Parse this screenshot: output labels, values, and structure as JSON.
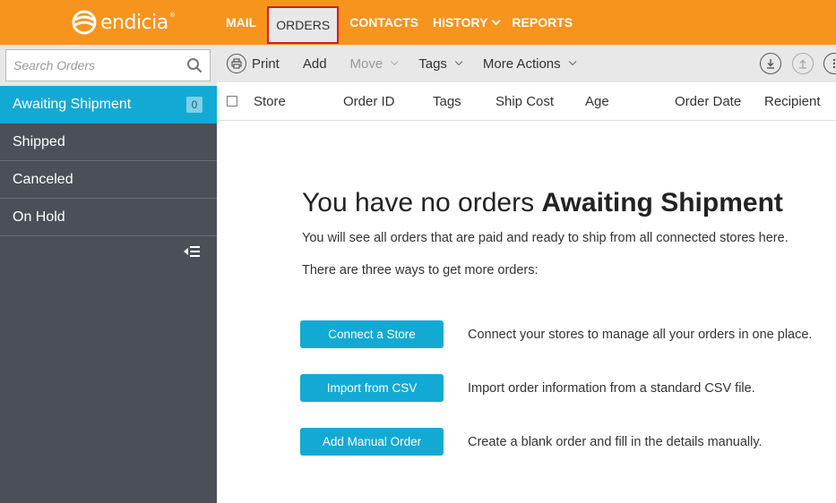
{
  "brand": {
    "name": "endicia",
    "mark": "®"
  },
  "nav": [
    {
      "label": "MAIL"
    },
    {
      "label": "ORDERS"
    },
    {
      "label": "CONTACTS"
    },
    {
      "label": "HISTORY"
    },
    {
      "label": "REPORTS"
    }
  ],
  "search": {
    "placeholder": "Search Orders"
  },
  "sidebar": {
    "items": [
      {
        "label": "Awaiting Shipment",
        "count": "0"
      },
      {
        "label": "Shipped"
      },
      {
        "label": "Canceled"
      },
      {
        "label": "On Hold"
      }
    ]
  },
  "toolbar": {
    "print": "Print",
    "add": "Add",
    "move": "Move",
    "tags": "Tags",
    "more_actions": "More Actions"
  },
  "table": {
    "columns": [
      "Store",
      "Order ID",
      "Tags",
      "Ship Cost",
      "Age",
      "Order Date",
      "Recipient"
    ]
  },
  "empty_state": {
    "title_prefix": "You have no orders ",
    "title_bold": "Awaiting Shipment",
    "subtitle": "You will see all orders that are paid and ready to ship from all connected stores here.",
    "ways_intro": "There are three ways to get more orders:",
    "ways": [
      {
        "button": "Connect a Store",
        "description": "Connect your stores to manage all your orders in one place."
      },
      {
        "button": "Import from CSV",
        "description": "Import order information from a standard CSV file."
      },
      {
        "button": "Add Manual Order",
        "description": "Create a blank order and fill in the details manually."
      }
    ]
  },
  "colors": {
    "brand_orange": "#f7941d",
    "accent_blue": "#12aad4",
    "sidebar_dark": "#4b5058"
  }
}
